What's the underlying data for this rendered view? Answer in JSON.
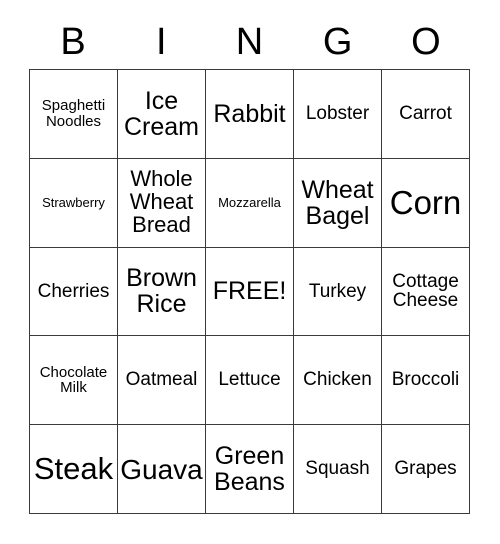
{
  "card": {
    "title": "BINGO Card",
    "header_letters": [
      "B",
      "I",
      "N",
      "G",
      "O"
    ],
    "free_space_label": "FREE!",
    "colors": {
      "background": "#ffffff",
      "text": "#000000",
      "grid_line": "#3a3a3a"
    },
    "columns": [
      {
        "letter": "B",
        "cells": [
          {
            "label": "Spaghetti Noodles",
            "size": "sm",
            "free": false
          },
          {
            "label": "Strawberry",
            "size": "xs",
            "free": false
          },
          {
            "label": "Cherries",
            "size": "md",
            "free": false
          },
          {
            "label": "Chocolate Milk",
            "size": "sm",
            "free": false
          },
          {
            "label": "Steak",
            "size": "3xl",
            "free": false
          }
        ]
      },
      {
        "letter": "I",
        "cells": [
          {
            "label": "Ice Cream",
            "size": "xl",
            "free": false
          },
          {
            "label": "Whole Wheat Bread",
            "size": "lg",
            "free": false
          },
          {
            "label": "Brown Rice",
            "size": "xl",
            "free": false
          },
          {
            "label": "Oatmeal",
            "size": "md",
            "free": false
          },
          {
            "label": "Guava",
            "size": "2xl",
            "free": false
          }
        ]
      },
      {
        "letter": "N",
        "cells": [
          {
            "label": "Rabbit",
            "size": "xl",
            "free": false
          },
          {
            "label": "Mozzarella",
            "size": "xs",
            "free": false
          },
          {
            "label": "FREE!",
            "size": "xl",
            "free": true
          },
          {
            "label": "Lettuce",
            "size": "md",
            "free": false
          },
          {
            "label": "Green Beans",
            "size": "xl",
            "free": false
          }
        ]
      },
      {
        "letter": "G",
        "cells": [
          {
            "label": "Lobster",
            "size": "md",
            "free": false
          },
          {
            "label": "Wheat Bagel",
            "size": "xl",
            "free": false
          },
          {
            "label": "Turkey",
            "size": "md",
            "free": false
          },
          {
            "label": "Chicken",
            "size": "md",
            "free": false
          },
          {
            "label": "Squash",
            "size": "md",
            "free": false
          }
        ]
      },
      {
        "letter": "O",
        "cells": [
          {
            "label": "Carrot",
            "size": "md",
            "free": false
          },
          {
            "label": "Corn",
            "size": "4xl",
            "free": false
          },
          {
            "label": "Cottage Cheese",
            "size": "md",
            "free": false
          },
          {
            "label": "Broccoli",
            "size": "md",
            "free": false
          },
          {
            "label": "Grapes",
            "size": "md",
            "free": false
          }
        ]
      }
    ],
    "rows": [
      [
        "Spaghetti Noodles",
        "Ice Cream",
        "Rabbit",
        "Lobster",
        "Carrot"
      ],
      [
        "Strawberry",
        "Whole Wheat Bread",
        "Mozzarella",
        "Wheat Bagel",
        "Corn"
      ],
      [
        "Cherries",
        "Brown Rice",
        "FREE!",
        "Turkey",
        "Cottage Cheese"
      ],
      [
        "Chocolate Milk",
        "Oatmeal",
        "Lettuce",
        "Chicken",
        "Broccoli"
      ],
      [
        "Steak",
        "Guava",
        "Green Beans",
        "Squash",
        "Grapes"
      ]
    ]
  }
}
